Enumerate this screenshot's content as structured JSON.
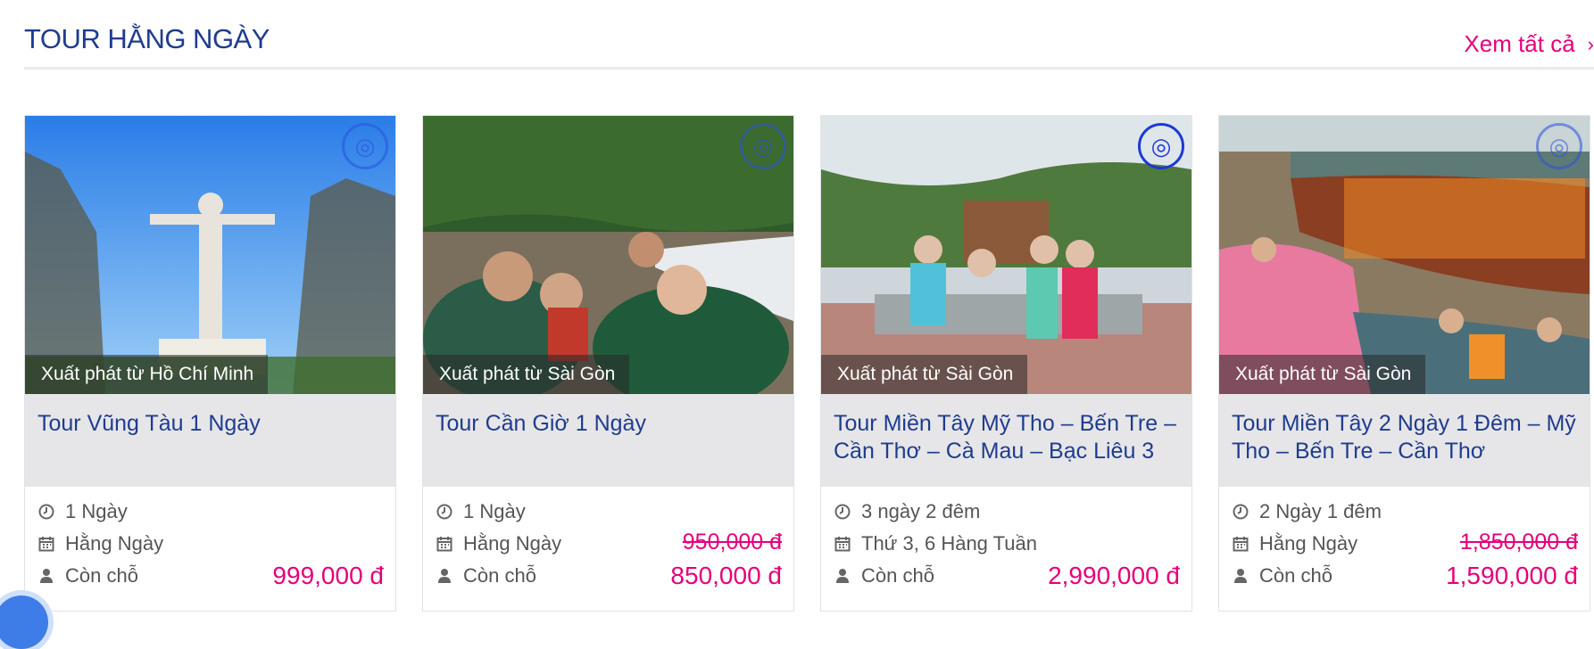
{
  "section": {
    "title": "TOUR HẰNG NGÀY",
    "see_all": "Xem tất cả"
  },
  "colors": {
    "accent": "#e4007b",
    "title_blue": "#1f3c8e",
    "title_bg": "#e6e6e8"
  },
  "labels": {
    "availability": "Còn chỗ"
  },
  "cards": [
    {
      "departure": "Xuất phát từ Hồ Chí Minh",
      "title": "Tour Vũng Tàu 1 Ngày",
      "duration": "1 Ngày",
      "schedule": "Hằng Ngày",
      "price_old": "",
      "price": "999,000 đ"
    },
    {
      "departure": "Xuất phát từ Sài Gòn",
      "title": "Tour Cần Giờ 1 Ngày",
      "duration": "1 Ngày",
      "schedule": "Hằng Ngày",
      "price_old": "950,000 đ",
      "price": "850,000 đ"
    },
    {
      "departure": "Xuất phát từ Sài Gòn",
      "title": "Tour Miền Tây Mỹ Tho – Bến Tre – Cần Thơ – Cà Mau – Bạc Liêu 3",
      "duration": "3 ngày 2 đêm",
      "schedule": "Thứ 3, 6 Hàng Tuần",
      "price_old": "",
      "price": "2,990,000 đ"
    },
    {
      "departure": "Xuất phát từ Sài Gòn",
      "title": "Tour Miền Tây 2 Ngày 1 Đêm – Mỹ Tho – Bến Tre – Cần Thơ",
      "duration": "2 Ngày 1 đêm",
      "schedule": "Hằng Ngày",
      "price_old": "1,850,000 đ",
      "price": "1,590,000 đ"
    }
  ],
  "icons": {
    "duration": "clock-icon",
    "schedule": "calendar-icon",
    "availability": "user-icon",
    "see_all": "chevron-right-icon",
    "badge": "dragon-logo-icon"
  }
}
